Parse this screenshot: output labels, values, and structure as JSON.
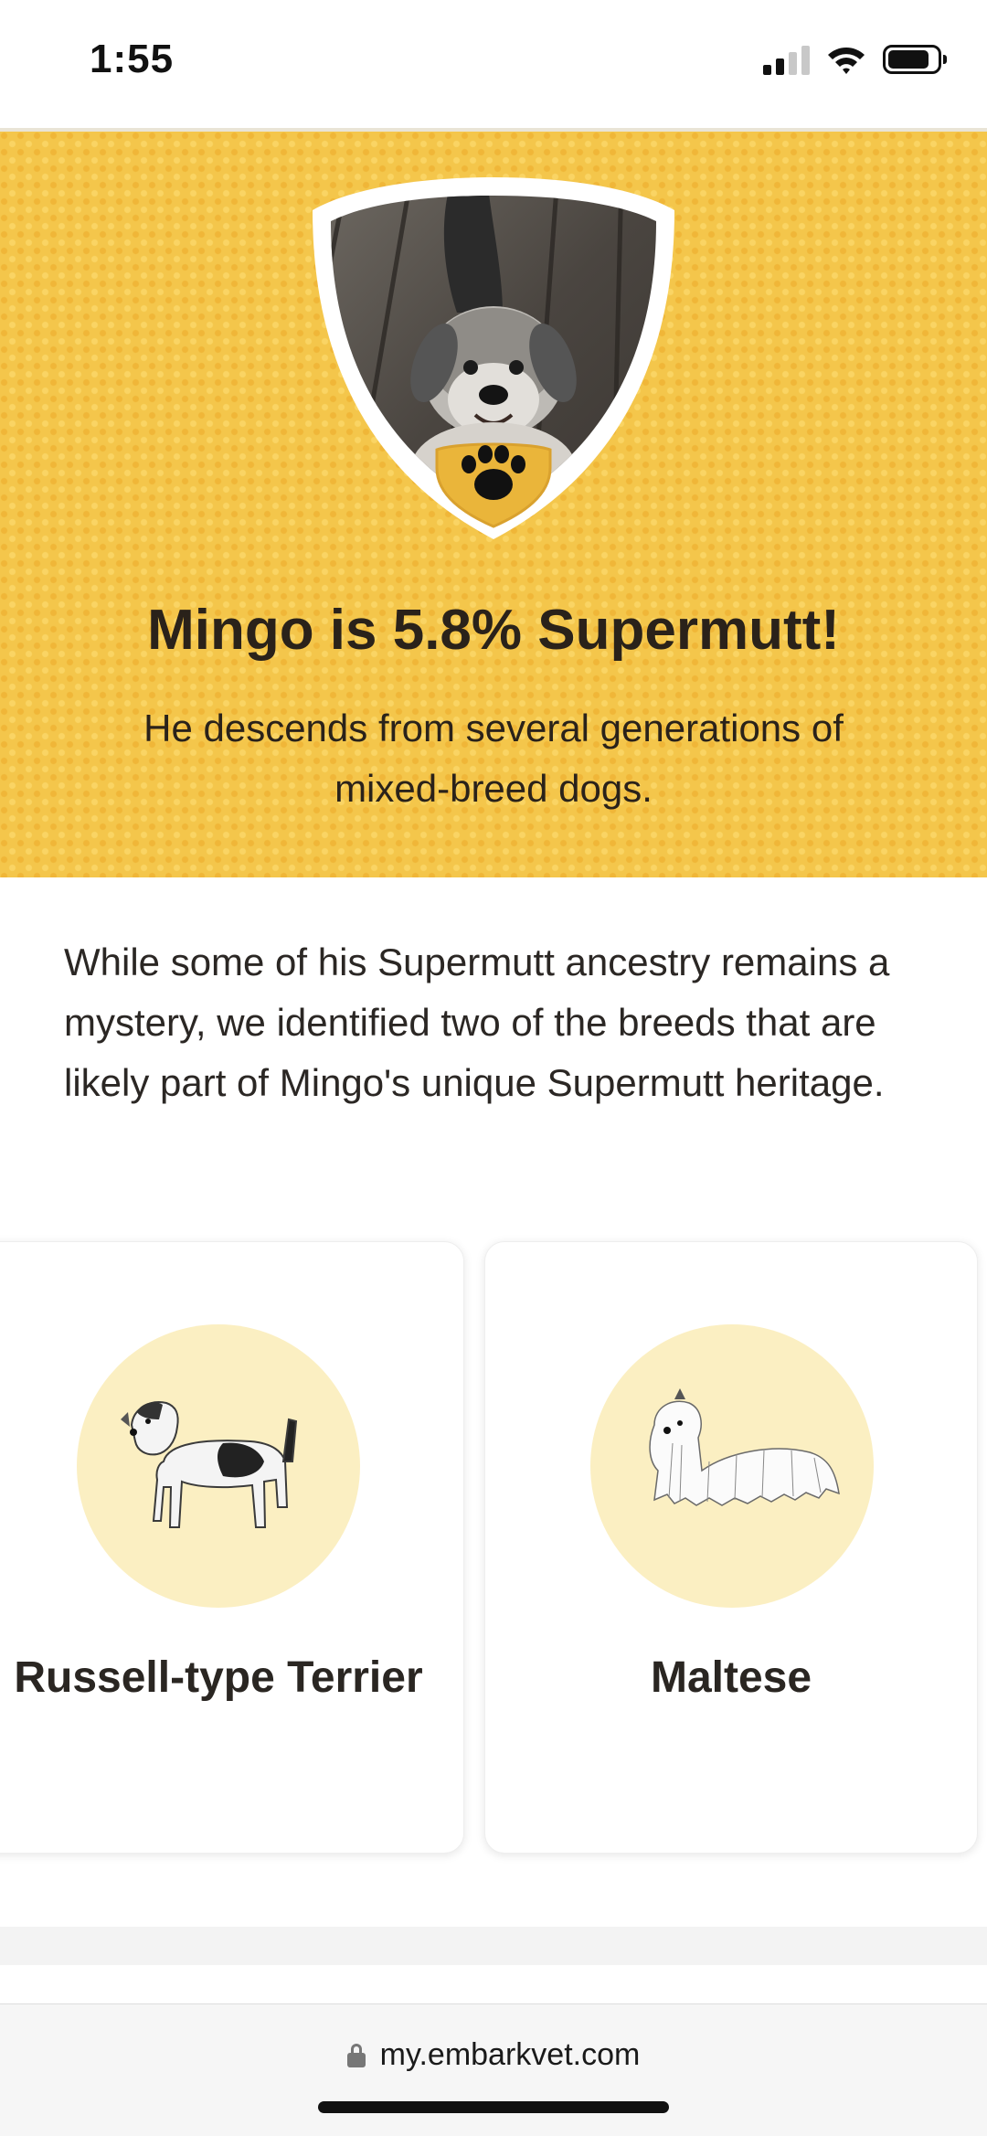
{
  "status_bar": {
    "time": "1:55",
    "signal_icon": "cellular-signal-icon",
    "wifi_icon": "wifi-icon",
    "battery_icon": "battery-icon",
    "signal_bars_active": 2,
    "signal_bars_total": 4,
    "battery_level": 0.75
  },
  "hero": {
    "title": "Mingo is 5.8% Supermutt!",
    "subtitle": "He descends from several generations of mixed-breed dogs.",
    "photo_icon": "dog-photo",
    "badge_icon": "paw-icon",
    "background_color": "#f4c64b"
  },
  "intro": {
    "text": "While some of his Supermutt ancestry remains a mystery, we identified two of the breeds that are likely part of Mingo's unique Supermutt heritage."
  },
  "breeds": [
    {
      "name": "Russell-type Terrier",
      "icon": "terrier-illustration"
    },
    {
      "name": "Maltese",
      "icon": "maltese-illustration"
    }
  ],
  "browser": {
    "url": "my.embarkvet.com",
    "lock_icon": "lock-icon"
  }
}
